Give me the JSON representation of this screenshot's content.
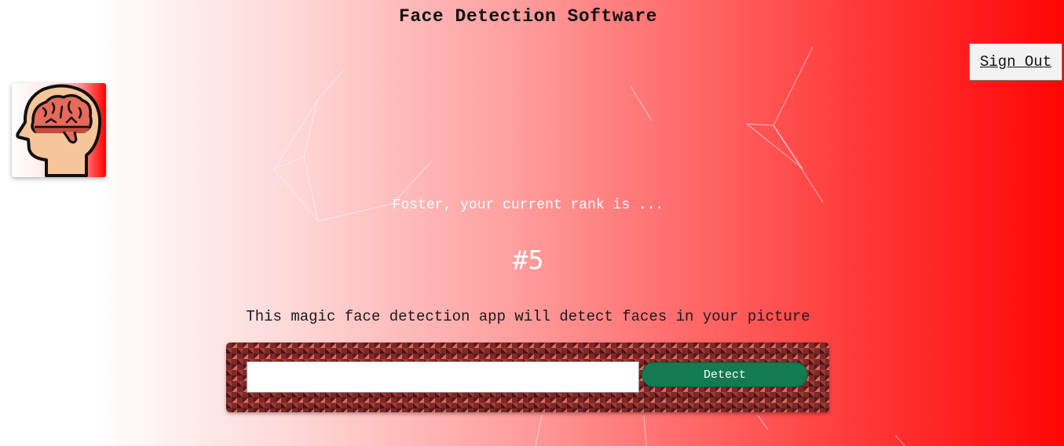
{
  "header": {
    "title": "Face Detection Software"
  },
  "nav": {
    "signout_label": "Sign Out"
  },
  "logo": {
    "icon": "brain-head-icon"
  },
  "rank": {
    "intro": "Foster, your current rank is ...",
    "value": "#5"
  },
  "description": "This magic face detection app will detect faces in your picture",
  "form": {
    "input_value": "",
    "detect_label": "Detect"
  },
  "colors": {
    "background_start": "#ffffff",
    "background_end": "#ff0505",
    "detect_button": "#137a52",
    "panel_pattern": "#7a2a2a"
  }
}
